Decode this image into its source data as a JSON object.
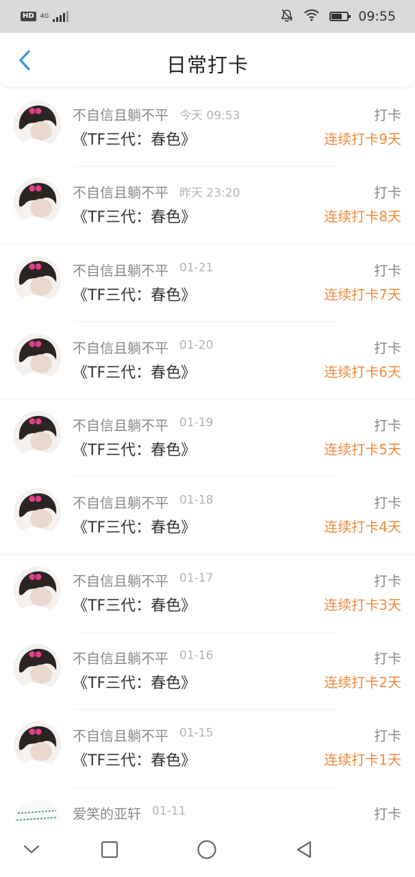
{
  "status_bar": {
    "hd": "HD",
    "network": "4G",
    "time": "09:55",
    "icons": [
      "signal-icon",
      "mute-bell-icon",
      "wifi-icon",
      "battery-icon"
    ]
  },
  "header": {
    "title": "日常打卡",
    "back_icon": "back-chevron-icon",
    "accent_color": "#3a8fe0"
  },
  "records": [
    {
      "user": "不自信且躺不平",
      "time": "今天 09:53",
      "book": "《TF三代：春色》",
      "action": "打卡",
      "streak": "连续打卡9天"
    },
    {
      "user": "不自信且躺不平",
      "time": "昨天 23:20",
      "book": "《TF三代：春色》",
      "action": "打卡",
      "streak": "连续打卡8天"
    },
    {
      "user": "不自信且躺不平",
      "time": "01-21",
      "book": "《TF三代：春色》",
      "action": "打卡",
      "streak": "连续打卡7天"
    },
    {
      "user": "不自信且躺不平",
      "time": "01-20",
      "book": "《TF三代：春色》",
      "action": "打卡",
      "streak": "连续打卡6天"
    },
    {
      "user": "不自信且躺不平",
      "time": "01-19",
      "book": "《TF三代：春色》",
      "action": "打卡",
      "streak": "连续打卡5天"
    },
    {
      "user": "不自信且躺不平",
      "time": "01-18",
      "book": "《TF三代：春色》",
      "action": "打卡",
      "streak": "连续打卡4天"
    },
    {
      "user": "不自信且躺不平",
      "time": "01-17",
      "book": "《TF三代：春色》",
      "action": "打卡",
      "streak": "连续打卡3天"
    },
    {
      "user": "不自信且躺不平",
      "time": "01-16",
      "book": "《TF三代：春色》",
      "action": "打卡",
      "streak": "连续打卡2天"
    },
    {
      "user": "不自信且躺不平",
      "time": "01-15",
      "book": "《TF三代：春色》",
      "action": "打卡",
      "streak": "连续打卡1天"
    },
    {
      "user": "爱笑的亚轩",
      "time": "01-11",
      "book": "",
      "action": "打卡",
      "streak": ""
    }
  ],
  "nav_bar": {
    "icons": [
      "collapse-chevron-icon",
      "recents-square-icon",
      "home-circle-icon",
      "back-triangle-icon"
    ]
  },
  "colors": {
    "streak": "#f0883a",
    "muted_text": "#8a8a8a",
    "status_bar_bg": "#d9d9d9"
  }
}
